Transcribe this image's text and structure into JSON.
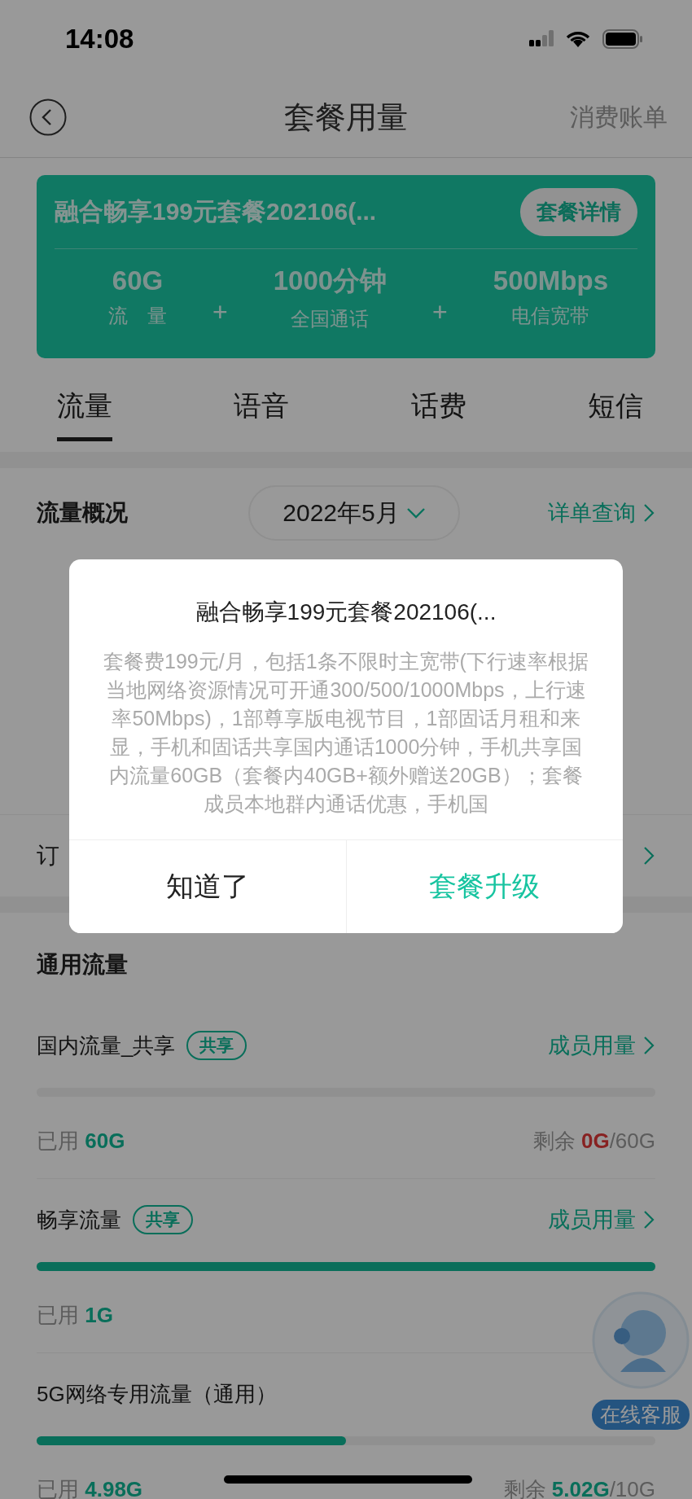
{
  "status_bar": {
    "time": "14:08"
  },
  "nav": {
    "title": "套餐用量",
    "action": "消费账单"
  },
  "plan_card": {
    "name": "融合畅享199元套餐202106(...",
    "details_button": "套餐详情",
    "items": [
      {
        "value": "60G",
        "label": "流　量"
      },
      {
        "value": "1000分钟",
        "label": "全国通话"
      },
      {
        "value": "500Mbps",
        "label": "电信宽带"
      }
    ],
    "separators": [
      "+",
      "+"
    ]
  },
  "tabs": [
    {
      "label": "流量",
      "selected": true
    },
    {
      "label": "语音",
      "selected": false
    },
    {
      "label": "话费",
      "selected": false
    },
    {
      "label": "短信",
      "selected": false
    }
  ],
  "overview": {
    "title": "流量概况",
    "month": "2022年5月",
    "link": "详单查询"
  },
  "order_row": {
    "label": "订"
  },
  "usage": {
    "title": "通用流量",
    "items": [
      {
        "name": "国内流量_共享",
        "badge": "共享",
        "link": "成员用量",
        "level": 0,
        "used_label": "已用",
        "used": "60G",
        "remain_label": "剩余",
        "remain": "0G",
        "total": "/60G",
        "remain_alert": true
      },
      {
        "name": "畅享流量",
        "badge": "共享",
        "link": "成员用量",
        "level": 1,
        "used_label": "已用",
        "used": "1G"
      },
      {
        "name": "5G网络专用流量（通用）",
        "level": 0.5,
        "used_label": "已用",
        "used": "4.98G",
        "remain_label": "剩余",
        "remain": "5.02G",
        "total": "/10G",
        "remain_alert": false
      }
    ]
  },
  "chat_button": {
    "label": "在线客服"
  },
  "dialog": {
    "title": "融合畅享199元套餐202106(...",
    "body": "套餐费199元/月，包括1条不限时主宽带(下行速率根据当地网络资源情况可开通300/500/1000Mbps，上行速率50Mbps)，1部尊享版电视节目，1部固话月租和来显，手机和固话共享国内通话1000分钟，手机共享国内流量60GB（套餐内40GB+额外赠送20GB）；套餐成员本地群内通话优惠，手机国",
    "buttons": [
      {
        "label": "知道了",
        "kind": "dismiss"
      },
      {
        "label": "套餐升级",
        "kind": "primary"
      }
    ]
  }
}
